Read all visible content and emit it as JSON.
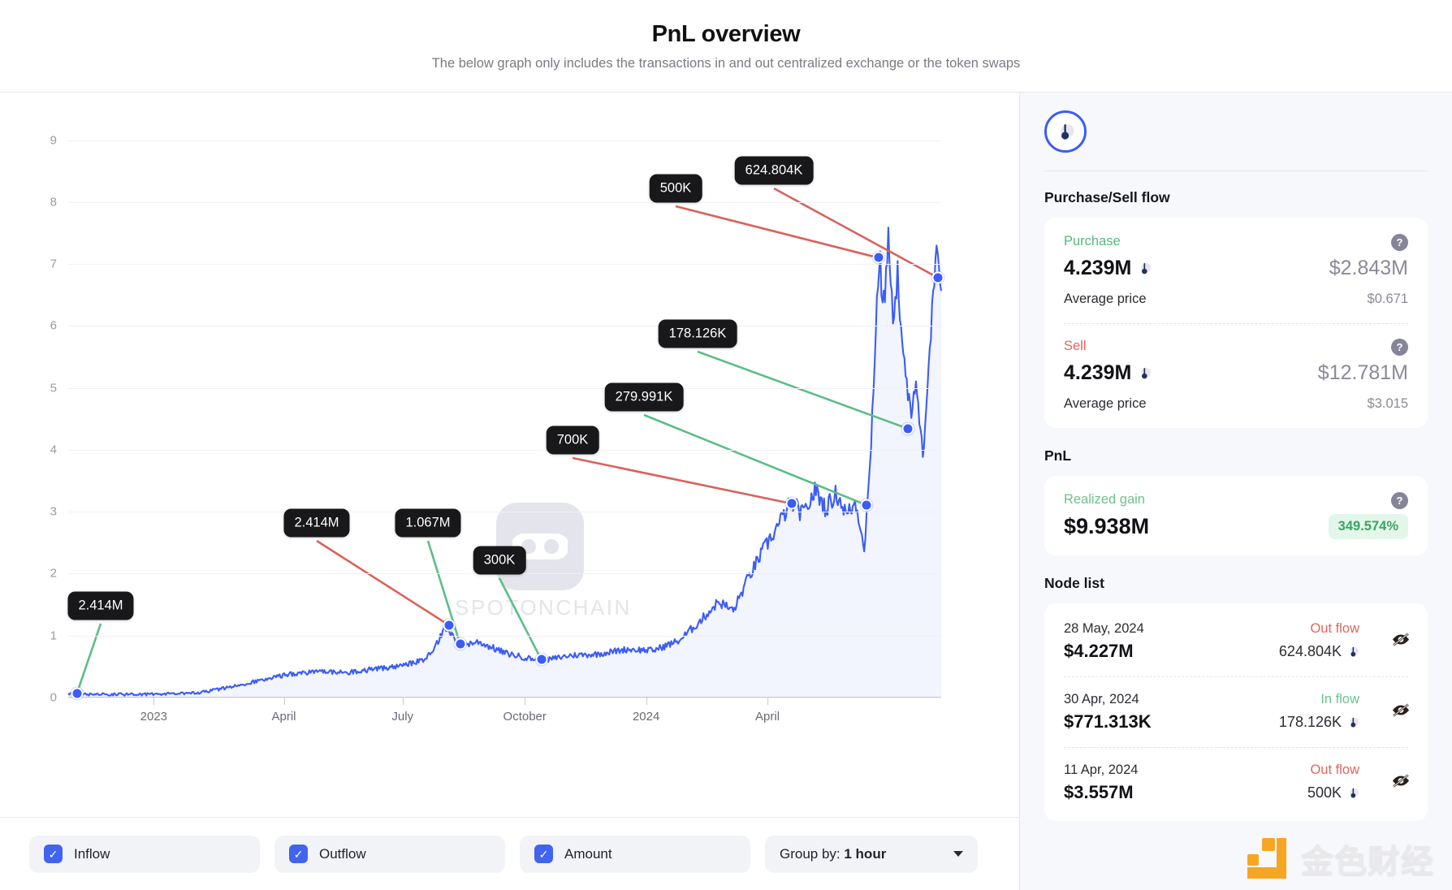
{
  "header": {
    "title": "PnL overview",
    "subtitle": "The below graph only includes the transactions in and out centralized exchange or the token swaps"
  },
  "watermark": {
    "text": "SPOTONCHAIN",
    "logo_icon": "spotonchain-logo-icon"
  },
  "corner_watermark": {
    "text": "金色财经",
    "logo_icon": "jinse-logo-icon"
  },
  "chart_data": {
    "type": "line",
    "title": "PnL overview",
    "xlabel": "",
    "ylabel": "",
    "ylim": [
      0,
      9.4
    ],
    "yticks": [
      0,
      1,
      2,
      3,
      4,
      5,
      6,
      7,
      8,
      9
    ],
    "xticks": [
      "2023",
      "April",
      "July",
      "October",
      "2024",
      "April"
    ],
    "grid": true,
    "legend_position": "bottom",
    "series": [
      {
        "name": "Amount",
        "color": "#3b5cf6",
        "fill": "#e8ecfd"
      }
    ],
    "annotations": [
      {
        "label": "2.414M",
        "type": "inflow",
        "color": "#5dbd86",
        "x_frac": 0.01,
        "y_value": 0.07
      },
      {
        "label": "2.414M",
        "type": "outflow",
        "color": "#d9625c",
        "x_frac": 0.436,
        "y_value": 1.17
      },
      {
        "label": "1.067M",
        "type": "inflow",
        "color": "#5dbd86",
        "x_frac": 0.449,
        "y_value": 0.86
      },
      {
        "label": "300K",
        "type": "inflow",
        "color": "#5dbd86",
        "x_frac": 0.542,
        "y_value": 0.61
      },
      {
        "label": "700K",
        "type": "outflow",
        "color": "#d9625c",
        "x_frac": 0.829,
        "y_value": 3.13
      },
      {
        "label": "279.991K",
        "type": "inflow",
        "color": "#5dbd86",
        "x_frac": 0.914,
        "y_value": 3.11
      },
      {
        "label": "178.126K",
        "type": "inflow",
        "color": "#5dbd86",
        "x_frac": 0.962,
        "y_value": 4.34
      },
      {
        "label": "500K",
        "type": "outflow",
        "color": "#d9625c",
        "x_frac": 0.928,
        "y_value": 7.1
      },
      {
        "label": "624.804K",
        "type": "outflow",
        "color": "#d9625c",
        "x_frac": 0.996,
        "y_value": 6.78
      }
    ]
  },
  "toolbar": {
    "inflow_label": "Inflow",
    "outflow_label": "Outflow",
    "amount_label": "Amount",
    "group_by_prefix": "Group by: ",
    "group_by_value": "1 hour",
    "check_glyph": "✓"
  },
  "sidebar": {
    "token_icon": "token-thermometer-icon",
    "purchase_sell": {
      "section_title": "Purchase/Sell flow",
      "purchase": {
        "label": "Purchase",
        "amount": "4.239M",
        "usd": "$2.843M",
        "avg_label": "Average price",
        "avg_value": "$0.671",
        "help": "?"
      },
      "sell": {
        "label": "Sell",
        "amount": "4.239M",
        "usd": "$12.781M",
        "avg_label": "Average price",
        "avg_value": "$3.015",
        "help": "?"
      }
    },
    "pnl": {
      "section_title": "PnL",
      "label": "Realized gain",
      "amount": "$9.938M",
      "percent": "349.574%",
      "help": "?"
    },
    "node_list": {
      "section_title": "Node list",
      "rows": [
        {
          "date": "28 May, 2024",
          "flow": "Out flow",
          "flow_type": "out",
          "usd": "$4.227M",
          "qty": "624.804K"
        },
        {
          "date": "30 Apr, 2024",
          "flow": "In flow",
          "flow_type": "in",
          "usd": "$771.313K",
          "qty": "178.126K"
        },
        {
          "date": "11 Apr, 2024",
          "flow": "Out flow",
          "flow_type": "out",
          "usd": "$3.557M",
          "qty": "500K"
        }
      ]
    }
  },
  "colors": {
    "accent": "#3b5cf6",
    "inflow": "#5dbd86",
    "outflow": "#d9625c",
    "positive": "#3aa563"
  }
}
